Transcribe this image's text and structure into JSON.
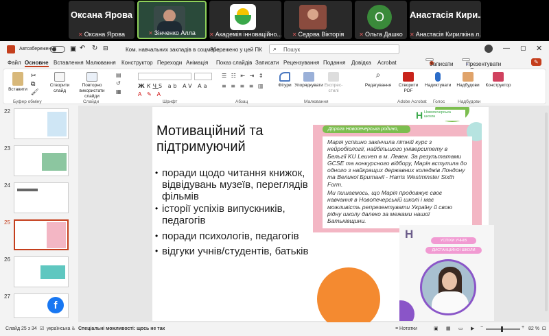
{
  "teams": {
    "tiles": [
      {
        "name": "Оксана Ярова",
        "label": "Оксана Ярова"
      },
      {
        "label": "Зінченко Алла"
      },
      {
        "label": "Академія інноваційно..."
      },
      {
        "label": "Седова Вікторія"
      },
      {
        "initial": "O",
        "label": "Ольга Дашко"
      },
      {
        "name": "Анастасія Кири...",
        "label": "Анастасія Кирилкіна л..."
      }
    ]
  },
  "titlebar": {
    "autosave": "Автозбереження",
    "doc": "Ком. навчальних закладів в соцмере...",
    "saved": "Збережено у цей ПК",
    "search": "Пошук",
    "record_btn": "Записати",
    "present_btn": "Презентувати в Teams"
  },
  "tabs": [
    "Файл",
    "Основне",
    "Вставлення",
    "Малювання",
    "Конструктор",
    "Переходи",
    "Анімація",
    "Показ слайдів",
    "Записати",
    "Рецензування",
    "Подання",
    "Довідка",
    "Acrobat"
  ],
  "ribbon": {
    "paste": "Вставити",
    "new_slide": "Створити слайд",
    "reuse": "Повторно використати слайди",
    "shapes": "Фігури",
    "arrange": "Упорядкувати",
    "styles": "Експрес-стилі",
    "editing": "Редагування",
    "create_pdf": "Створити PDF",
    "dictate": "Надиктувати",
    "addins": "Надбудови",
    "designer": "Конструктор",
    "groups": [
      "Буфер обміну",
      "Слайди",
      "Шрифт",
      "Абзац",
      "Малювання",
      "Adobe Acrobat",
      "Голос",
      "Надбудови"
    ]
  },
  "thumbs": [
    {
      "num": "22"
    },
    {
      "num": "23"
    },
    {
      "num": "24"
    },
    {
      "num": "25"
    },
    {
      "num": "26"
    },
    {
      "num": "27"
    }
  ],
  "slide": {
    "title": "Мотиваційний та підтримуючий",
    "bullets": [
      "поради щодо читання книжок, відвідувань музеїв, переглядів фільмів",
      "історії успіхів випускників, педагогів",
      " поради психологів, педагогів",
      "відгуки учнів/студентів, батьків"
    ],
    "card": {
      "logo": "Новопечерська школа",
      "greet": "Дорога Новопечерська родино,",
      "p1": "Марія успішно закінчила літній курс з нейробіології, найбільшого університету в Бельгії KU Leuven в м. Левен. За результатами GCSE та конкурсного відбору, Марія вступила до одного з найкращих державних коледжів Лондону та Великої Британії - Harris Westminster Sixth Form.",
      "p2": "Ми пишаємось, що Марія продовжує своє навчання в Новопечерській школі і має можливість репрезентувати Україну й свою рідну школу далеко за межами нашої Батьківщини."
    },
    "photo": {
      "tag1": "УСПІХИ УЧНІВ",
      "tag2": "ДИСТАНЦІЙНОЇ ШКОЛИ"
    }
  },
  "status": {
    "slide": "Слайд 25 з 34",
    "lang": "українська",
    "access": "Спеціальні можливості: щось не так",
    "notes": "Нотатки",
    "zoom": "82 %"
  },
  "colors": {
    "accent": "#c43e1c",
    "teams_bg": "#000000",
    "pink": "#f3b6c4",
    "green": "#7cbe4f"
  }
}
